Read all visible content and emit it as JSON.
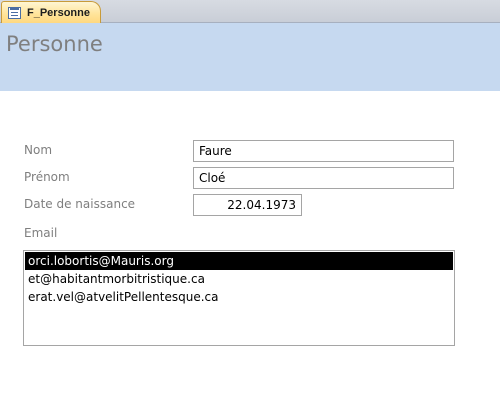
{
  "tab": {
    "label": "F_Personne",
    "icon": "form-icon"
  },
  "form": {
    "title": "Personne"
  },
  "fields": {
    "nom": {
      "label": "Nom",
      "value": "Faure"
    },
    "prenom": {
      "label": "Prénom",
      "value": "Cloé"
    },
    "date_naissance": {
      "label": "Date de naissance",
      "value": "22.04.1973"
    },
    "email": {
      "label": "Email",
      "items": [
        "orci.lobortis@Mauris.org",
        "et@habitantmorbitristique.ca",
        "erat.vel@atvelitPellentesque.ca"
      ],
      "selected_index": 0
    }
  },
  "colors": {
    "header_band": "#c6d9f0",
    "label_text": "#7f7f7f",
    "tab_active": "#ffd77c",
    "selection": "#000000"
  }
}
